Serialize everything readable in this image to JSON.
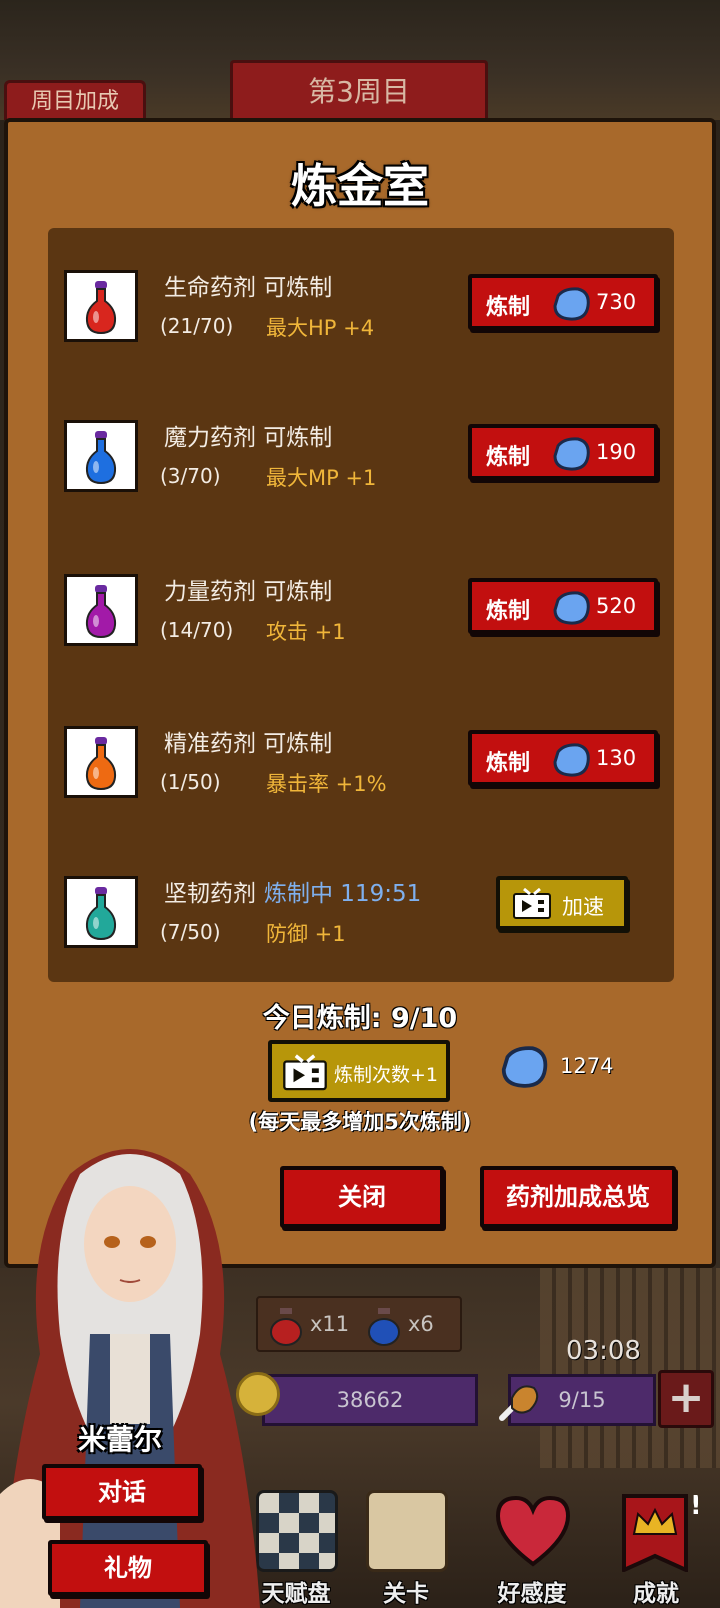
{
  "header": {
    "cycle_bonus_tab": "周目加成",
    "cycle_banner": "第3周目"
  },
  "panel": {
    "title": "炼金室",
    "potions": [
      {
        "name": "生命药剂 可炼制",
        "count": "(21/70)",
        "bonus": "最大HP +4",
        "button": "炼制",
        "cost": "730",
        "color": "#d8261e"
      },
      {
        "name": "魔力药剂 可炼制",
        "count": "(3/70)",
        "bonus": "最大MP +1",
        "button": "炼制",
        "cost": "190",
        "color": "#1e6fe0"
      },
      {
        "name": "力量药剂 可炼制",
        "count": "(14/70)",
        "bonus": "攻击 +1",
        "button": "炼制",
        "cost": "520",
        "color": "#a21aa8"
      },
      {
        "name": "精准药剂 可炼制",
        "count": "(1/50)",
        "bonus": "暴击率 +1%",
        "button": "炼制",
        "cost": "130",
        "color": "#ee6a12"
      },
      {
        "name": "坚韧药剂",
        "status": "炼制中 119:51",
        "count": "(7/50)",
        "bonus": "防御 +1",
        "button": "加速",
        "color": "#22a89a"
      }
    ],
    "daily_label": "今日炼制: 9/10",
    "add_count_label": "炼制次数+1",
    "gem_balance": "1274",
    "daily_note": "(每天最多增加5次炼制)",
    "close_label": "关闭",
    "overview_label": "药剂加成总览"
  },
  "hud": {
    "red_potion_count": "x11",
    "blue_potion_count": "x6",
    "gold": "38662",
    "timer": "03:08",
    "stamina": "9/15",
    "plus": "+"
  },
  "character": {
    "name": "米蕾尔",
    "talk_label": "对话",
    "gift_label": "礼物"
  },
  "nav": [
    {
      "label": "天赋盘",
      "icon": "talent-board-icon"
    },
    {
      "label": "关卡",
      "icon": "map-scroll-icon"
    },
    {
      "label": "好感度",
      "icon": "heart-icon"
    },
    {
      "label": "成就",
      "icon": "crown-banner-icon"
    }
  ],
  "colors": {
    "panel": "#a8692b",
    "list_bg": "#5b3612",
    "red_button": "#c20f0f",
    "gold_button": "#b7960a",
    "bonus_text": "#f0b63a",
    "brewing_text": "#7fb0ee"
  }
}
